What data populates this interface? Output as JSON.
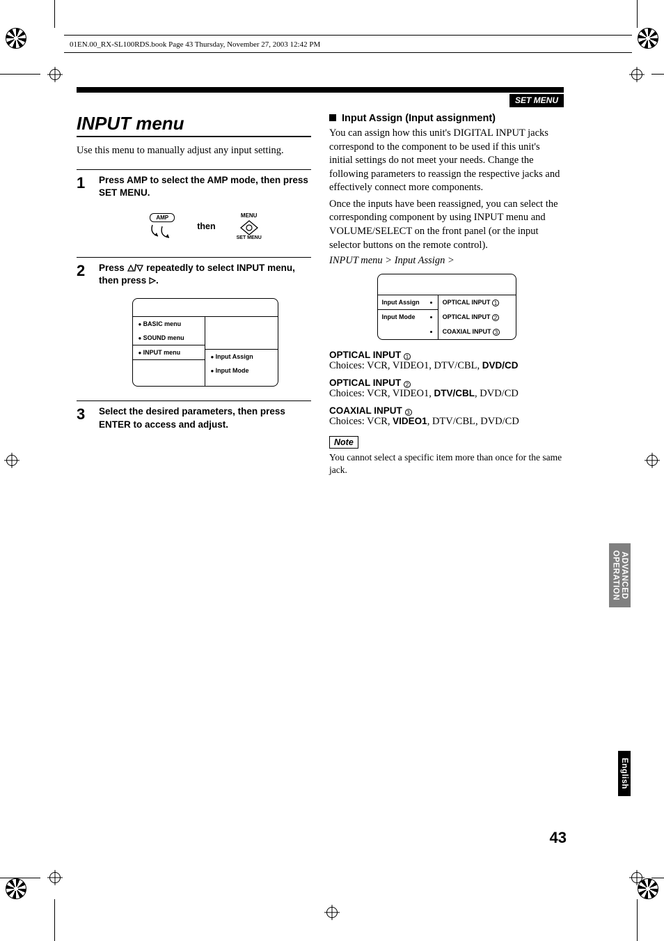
{
  "header_path": "01EN.00_RX-SL100RDS.book  Page 43  Thursday, November 27, 2003  12:42 PM",
  "section_tab": "SET MENU",
  "left": {
    "title": "INPUT menu",
    "intro": "Use this menu to manually adjust any input setting.",
    "step1": {
      "num": "1",
      "text": "Press AMP to select the AMP mode, then press SET MENU.",
      "amp_label": "AMP",
      "then": "then",
      "menu_label": "MENU",
      "setmenu_label": "SET MENU"
    },
    "step2": {
      "num": "2",
      "text_a": "Press ",
      "text_b": " repeatedly to select INPUT menu, then press ",
      "text_c": ".",
      "osd_left": [
        "BASIC menu",
        "SOUND menu",
        "INPUT menu"
      ],
      "osd_right": [
        "Input Assign",
        "Input Mode"
      ]
    },
    "step3": {
      "num": "3",
      "text": "Select the desired parameters, then press ENTER to access and adjust."
    }
  },
  "right": {
    "heading": "Input Assign (Input assignment)",
    "p1": "You can assign how this unit's DIGITAL INPUT jacks correspond to the component to be used if this unit's initial settings do not meet your needs. Change the following parameters to reassign the respective jacks and effectively connect more components.",
    "p2": "Once the inputs have been reassigned, you can select the corresponding component by using INPUT menu and VOLUME/SELECT on the front panel (or the input selector buttons on the remote control).",
    "breadcrumb": "INPUT menu > Input Assign >",
    "osd_left": [
      "Input Assign",
      "Input Mode"
    ],
    "osd_right": [
      "OPTICAL INPUT",
      "OPTICAL INPUT",
      "COAXIAL INPUT"
    ],
    "osd_right_nums": [
      "1",
      "2",
      "3"
    ],
    "defs": [
      {
        "t": "OPTICAL INPUT",
        "n": "1",
        "choices_a": "Choices: VCR, VIDEO1, DTV/CBL, ",
        "choices_b": "DVD/CD",
        "choices_c": ""
      },
      {
        "t": "OPTICAL INPUT",
        "n": "2",
        "choices_a": "Choices: VCR, VIDEO1, ",
        "choices_b": "DTV/CBL",
        "choices_c": ", DVD/CD"
      },
      {
        "t": "COAXIAL INPUT",
        "n": "3",
        "choices_a": "Choices: VCR, ",
        "choices_b": "VIDEO1",
        "choices_c": ", DTV/CBL, DVD/CD"
      }
    ],
    "note_t": "Note",
    "note_c": "You cannot select a specific item more than once for the same jack."
  },
  "sidetab1_l1": "ADVANCED",
  "sidetab1_l2": "OPERATION",
  "sidetab2": "English",
  "page_num": "43"
}
